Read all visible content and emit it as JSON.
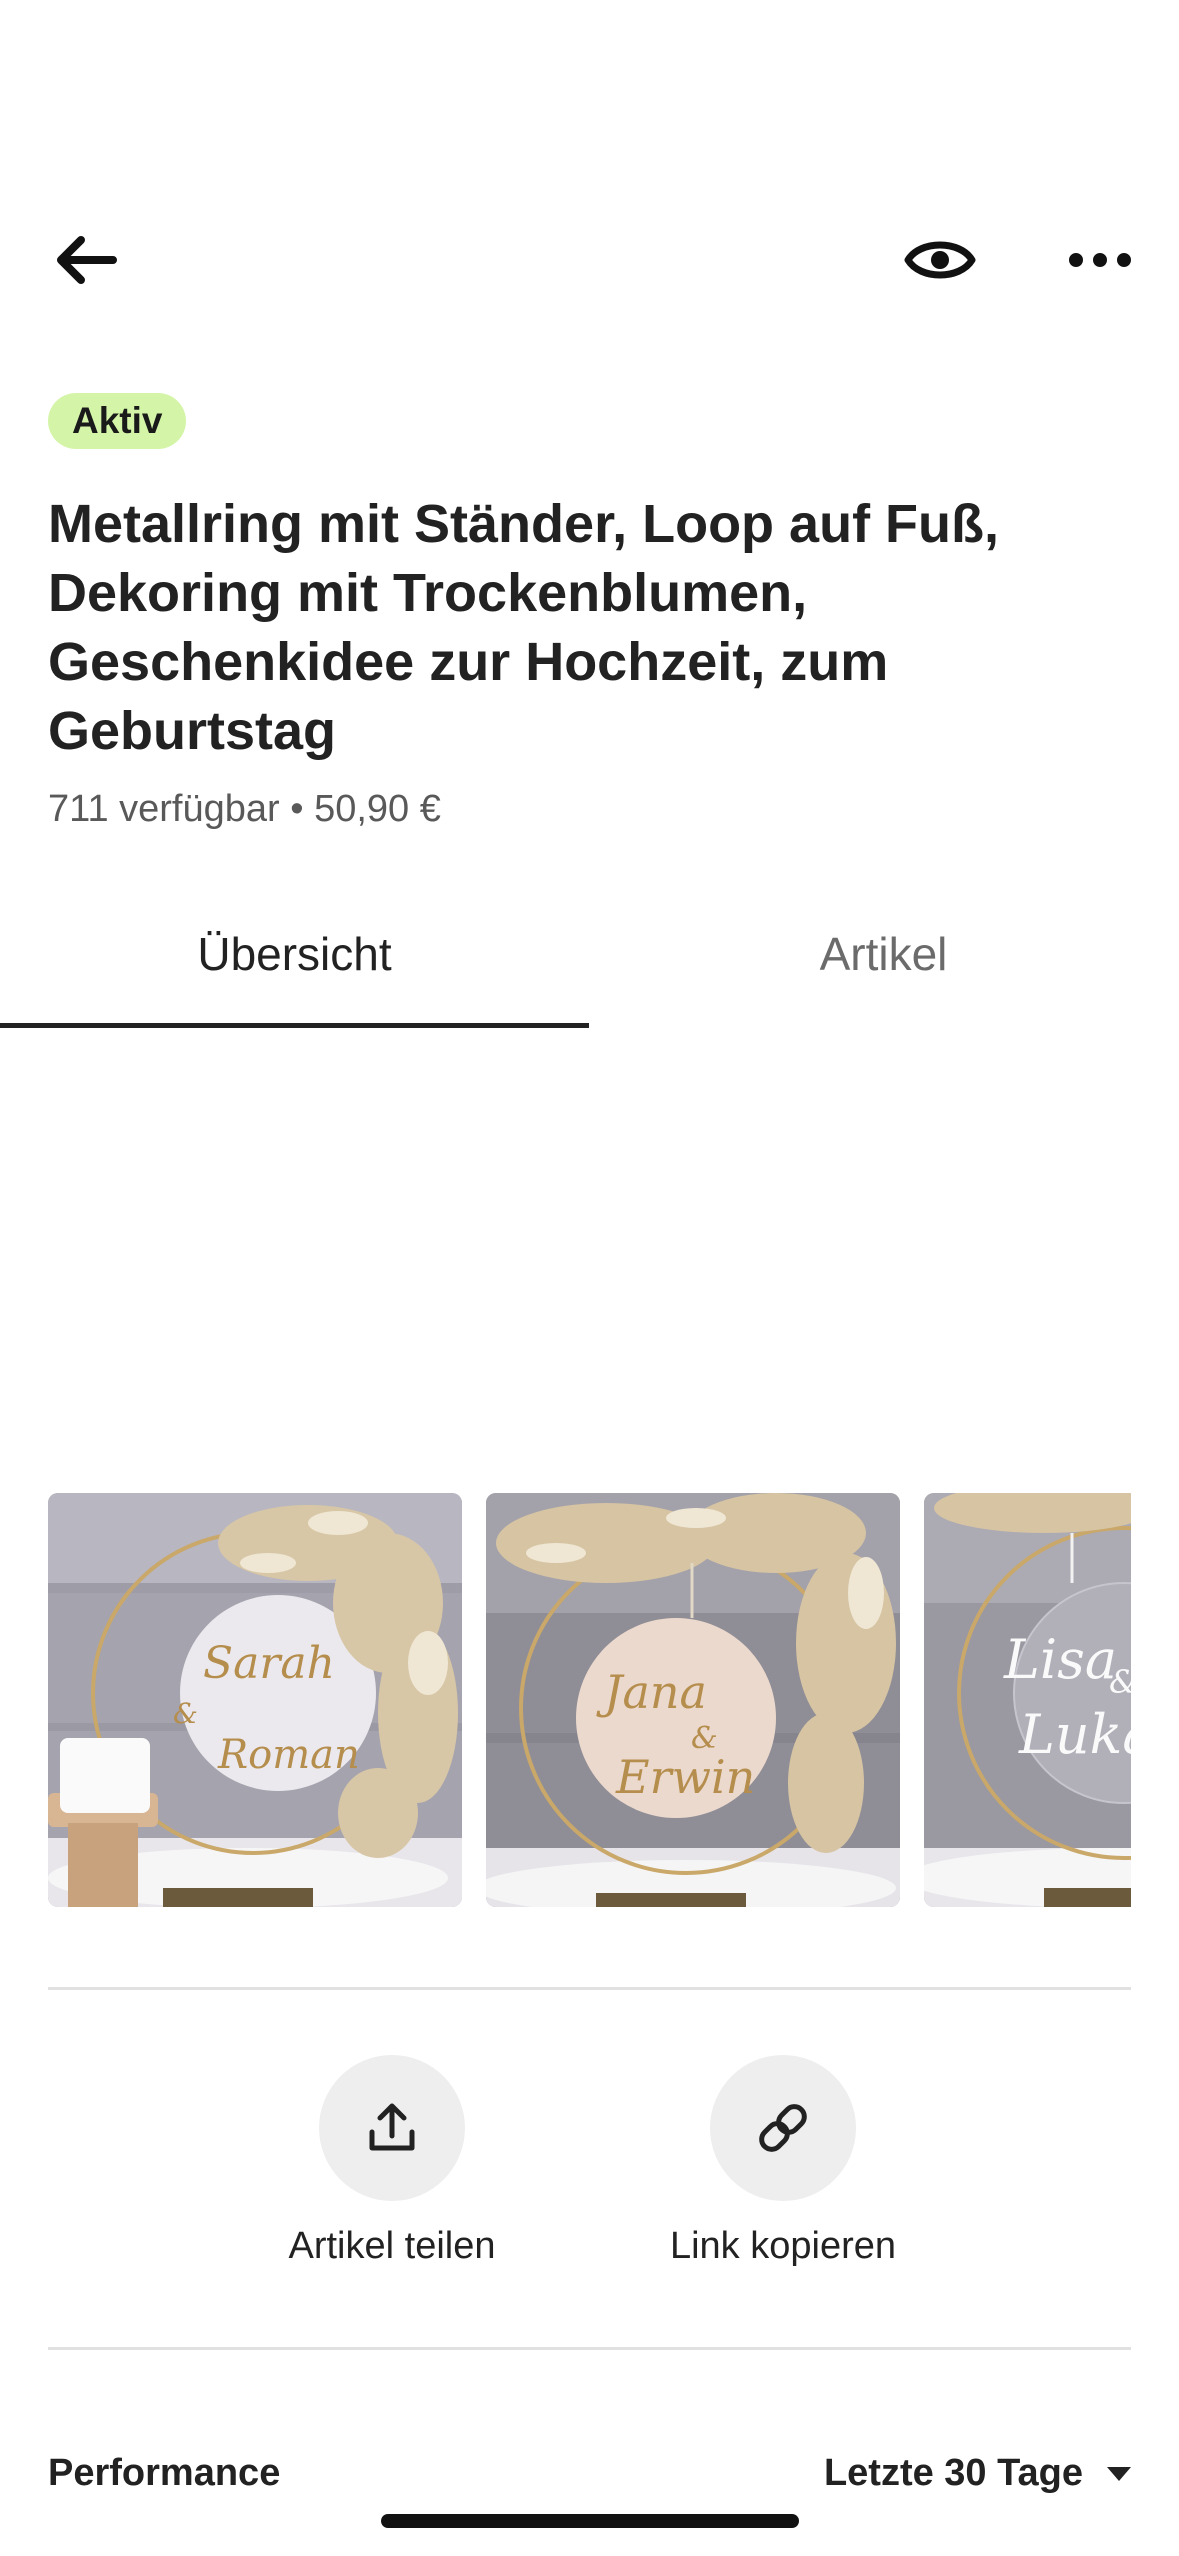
{
  "header": {
    "back_icon": "arrow-left-icon",
    "preview_icon": "eye-icon",
    "more_icon": "more-horizontal-icon"
  },
  "listing": {
    "status": "Aktiv",
    "status_color": "#d4f5a8",
    "title": "Metallring mit Ständer, Loop auf Fuß, Dekoring mit Trockenblumen, Geschenkidee zur Hochzeit, zum Geburtstag",
    "meta": "711 verfügbar • 50,90 €"
  },
  "tabs": [
    {
      "label": "Übersicht",
      "active": true
    },
    {
      "label": "Artikel",
      "active": false
    }
  ],
  "gallery": {
    "images": [
      {
        "sign_line1": "Sarah",
        "sign_amp": "&",
        "sign_line2": "Roman"
      },
      {
        "sign_line1": "Jana",
        "sign_amp": "&",
        "sign_line2": "Erwin"
      },
      {
        "sign_line1": "Lisa",
        "sign_amp": "&",
        "sign_line2": "Luka"
      }
    ]
  },
  "actions": [
    {
      "label": "Artikel teilen",
      "icon": "share-upload-icon"
    },
    {
      "label": "Link kopieren",
      "icon": "link-icon"
    }
  ],
  "performance": {
    "title": "Performance",
    "range": "Letzte 30 Tage",
    "range_icon": "caret-down-icon"
  }
}
